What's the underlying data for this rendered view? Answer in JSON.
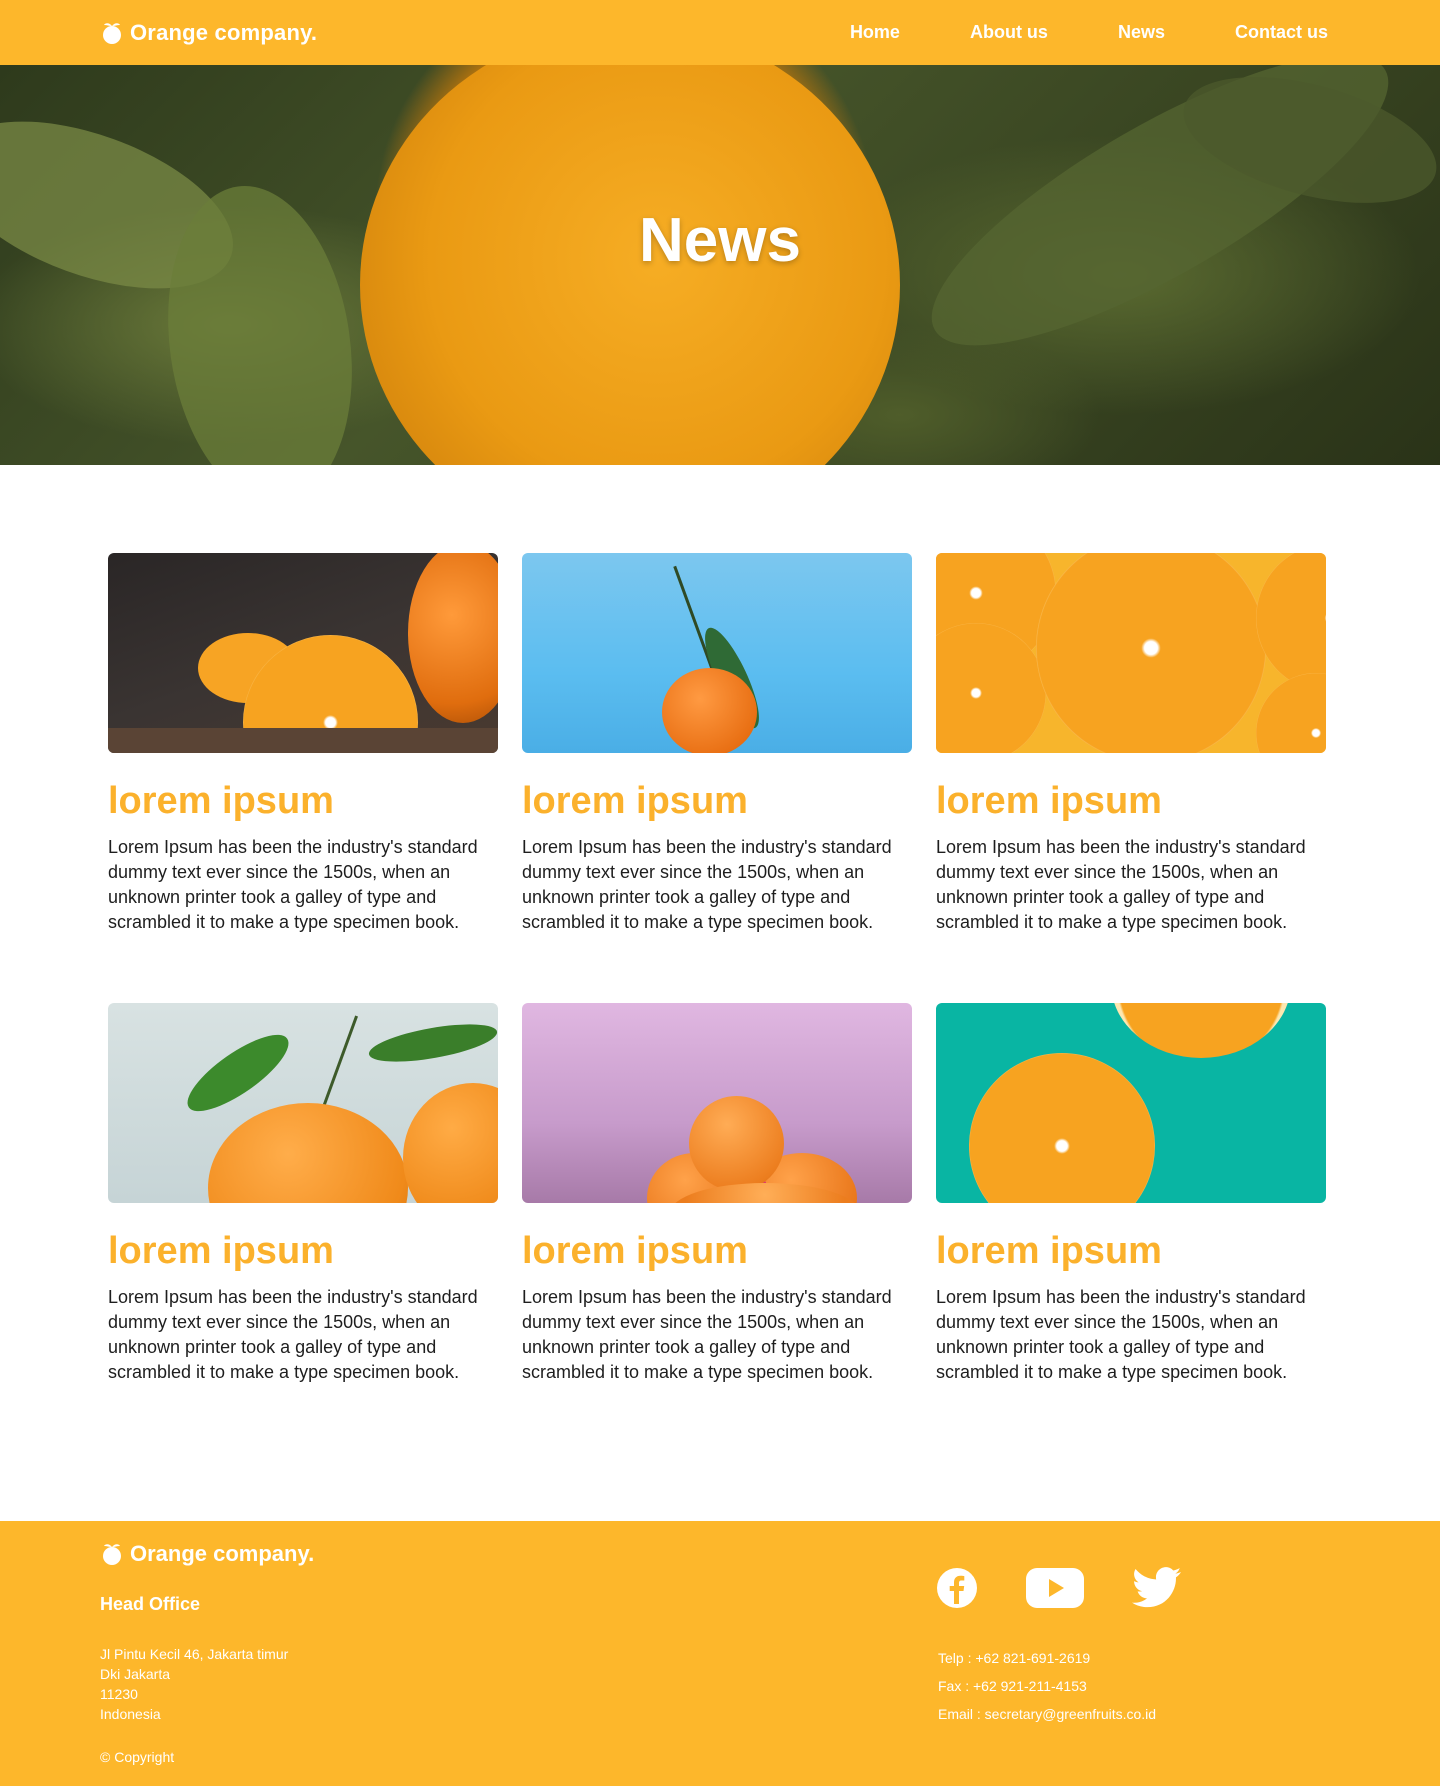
{
  "header": {
    "brand": "Orange company.",
    "nav": [
      "Home",
      "About us",
      "News",
      "Contact us"
    ]
  },
  "hero": {
    "title": "News"
  },
  "cards": [
    {
      "title": "lorem ipsum",
      "text": "Lorem Ipsum has been the industry's standard dummy text ever since the 1500s, when an unknown printer took a galley of type and scrambled it to make a type specimen book."
    },
    {
      "title": "lorem ipsum",
      "text": "Lorem Ipsum has been the industry's standard dummy text ever since the 1500s, when an unknown printer took a galley of type and scrambled it to make a type specimen book."
    },
    {
      "title": "lorem ipsum",
      "text": "Lorem Ipsum has been the industry's standard dummy text ever since the 1500s, when an unknown printer took a galley of type and scrambled it to make a type specimen book."
    },
    {
      "title": "lorem ipsum",
      "text": "Lorem Ipsum has been the industry's standard dummy text ever since the 1500s, when an unknown printer took a galley of type and scrambled it to make a type specimen book."
    },
    {
      "title": "lorem ipsum",
      "text": "Lorem Ipsum has been the industry's standard dummy text ever since the 1500s, when an unknown printer took a galley of type and scrambled it to make a type specimen book."
    },
    {
      "title": "lorem ipsum",
      "text": "Lorem Ipsum has been the industry's standard dummy text ever since the 1500s, when an unknown printer took a galley of type and scrambled it to make a type specimen book."
    }
  ],
  "footer": {
    "brand": "Orange company.",
    "head_office": "Head Office",
    "address": [
      "Jl Pintu Kecil 46, Jakarta timur",
      "Dki Jakarta",
      "11230",
      "Indonesia"
    ],
    "copyright": "© Copyright",
    "telp": "Telp : +62 821-691-2619",
    "fax": "Fax : +62 921-211-4153",
    "email": "Email : secretary@greenfruits.co.id",
    "social_icons": [
      "facebook-icon",
      "youtube-icon",
      "twitter-icon"
    ]
  },
  "colors": {
    "accent": "#fdb72b",
    "title_orange": "#fbb12c",
    "white": "#ffffff"
  }
}
